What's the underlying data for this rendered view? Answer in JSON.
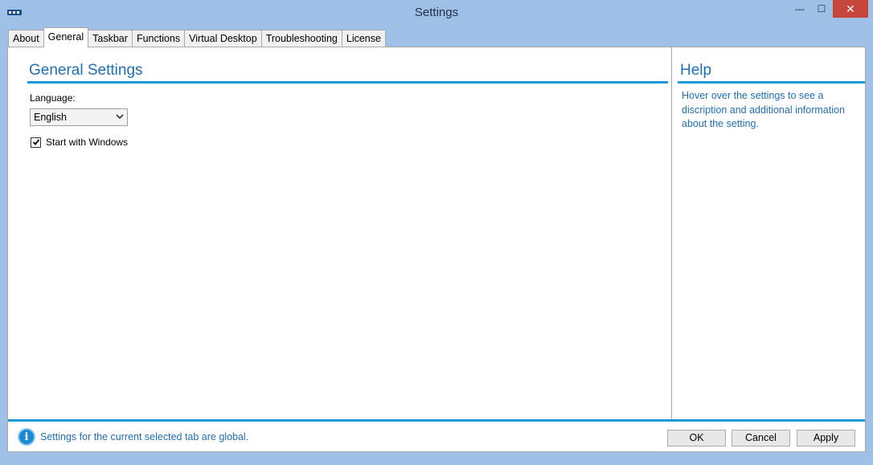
{
  "window": {
    "title": "Settings",
    "controls": {
      "minimize": "—",
      "maximize": "☐",
      "close": "✕"
    }
  },
  "tabs": [
    {
      "label": "About"
    },
    {
      "label": "General",
      "active": true
    },
    {
      "label": "Taskbar"
    },
    {
      "label": "Functions"
    },
    {
      "label": "Virtual Desktop"
    },
    {
      "label": "Troubleshooting"
    },
    {
      "label": "License"
    }
  ],
  "general": {
    "title": "General Settings",
    "language_label": "Language:",
    "language_value": "English",
    "start_with_windows_label": "Start with Windows",
    "start_with_windows_checked": true
  },
  "help": {
    "title": "Help",
    "text": "Hover over the settings to see a discription and additional information about the setting."
  },
  "status": {
    "icon": "info-icon",
    "text": "Settings for the current selected tab are global."
  },
  "buttons": {
    "ok": "OK",
    "cancel": "Cancel",
    "apply": "Apply"
  },
  "colors": {
    "accent": "#1a9ad6",
    "heading": "#1f6fb3",
    "window_frame": "#9ec0e6",
    "close_button": "#c7463c"
  }
}
